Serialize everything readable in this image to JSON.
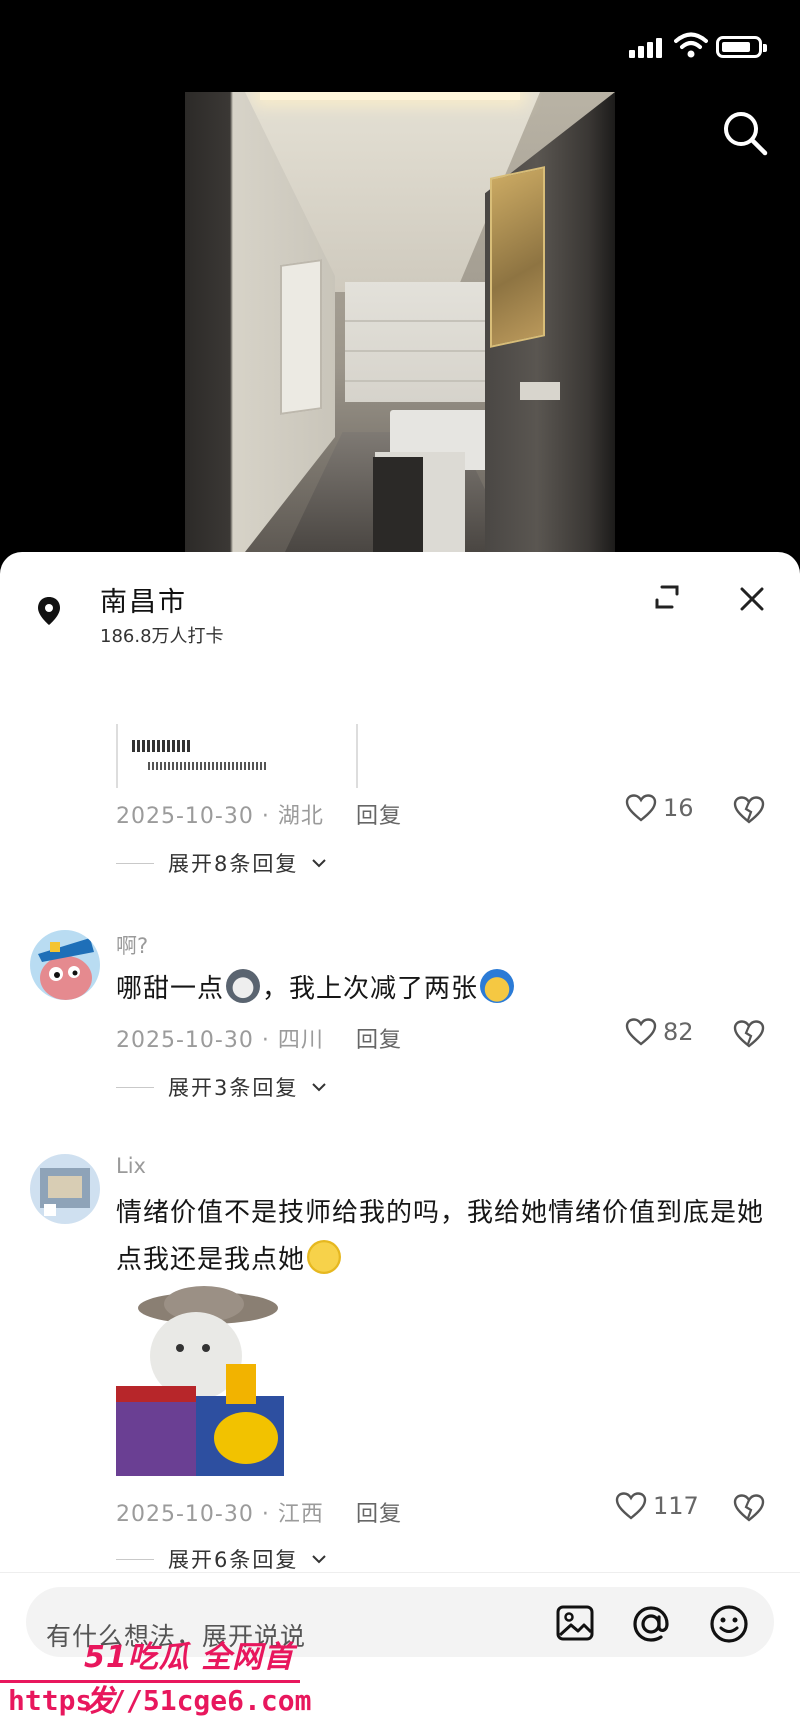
{
  "status_bar": {
    "battery_icon": "battery-icon",
    "wifi_icon": "wifi-icon",
    "signal_icon": "signal-icon"
  },
  "video": {
    "search_icon": "search-icon"
  },
  "location": {
    "name": "南昌市",
    "checkins": "186.8万人打卡"
  },
  "comments": [
    {
      "has_image": true,
      "date_region": "2025-10-30 · 湖北",
      "reply_label": "回复",
      "likes": "16",
      "expand_label": "展开8条回复"
    },
    {
      "user": "啊?",
      "text_a": "哪甜一点",
      "text_b": "，我上次减了两张",
      "date_region": "2025-10-30 · 四川",
      "reply_label": "回复",
      "likes": "82",
      "expand_label": "展开3条回复"
    },
    {
      "user": "Lix",
      "text_a": "情绪价值不是技师给我的吗，我给她情绪价值到底是她点我还是我点她",
      "date_region": "2025-10-30 · 江西",
      "reply_label": "回复",
      "likes": "117",
      "expand_label": "展开6条回复"
    }
  ],
  "input": {
    "placeholder": "有什么想法，展开说说"
  },
  "watermark": {
    "logo": "51吃瓜 全网首发",
    "url": "https://51cge6.com"
  },
  "colors": {
    "brand": "#e8175d",
    "muted": "#9b9b9b"
  }
}
